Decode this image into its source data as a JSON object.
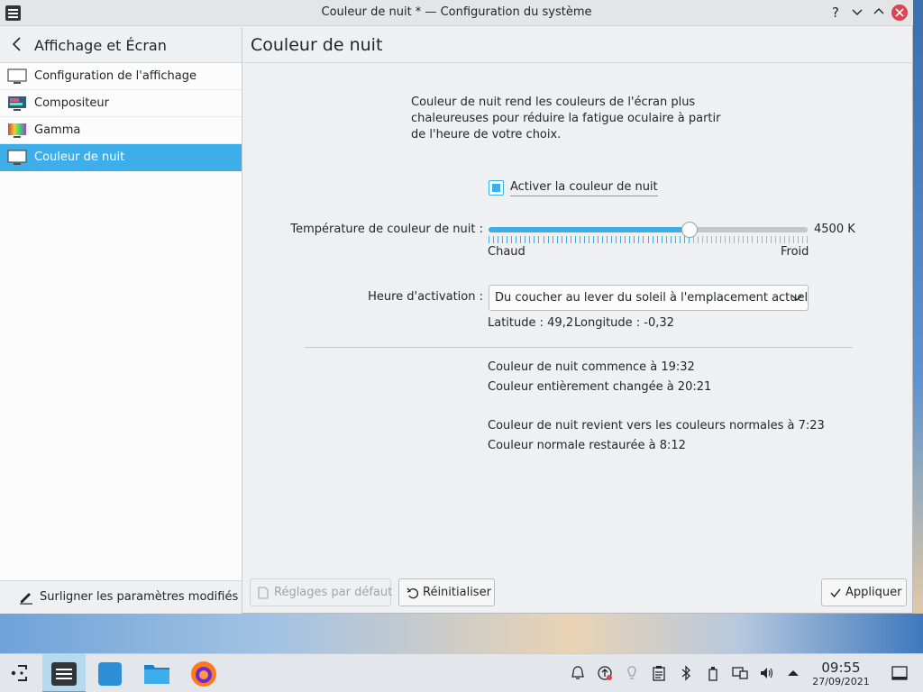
{
  "window": {
    "title": "Couleur de nuit * — Configuration du système",
    "buttons": {
      "help": "?",
      "minimize": "minimize",
      "maximize": "maximize",
      "close": "close"
    }
  },
  "sidebar": {
    "header": "Affichage et Écran",
    "items": [
      {
        "label": "Configuration de l'affichage",
        "icon": "display-icon",
        "active": false
      },
      {
        "label": "Compositeur",
        "icon": "compositor-icon",
        "active": false
      },
      {
        "label": "Gamma",
        "icon": "gamma-icon",
        "active": false
      },
      {
        "label": "Couleur de nuit",
        "icon": "night-color-icon",
        "active": true
      }
    ],
    "footer": "Surligner les paramètres modifiés"
  },
  "main": {
    "title": "Couleur de nuit",
    "description": "Couleur de nuit rend les couleurs de l'écran plus chaleureuses pour réduire la fatigue oculaire à partir de l'heure de votre choix.",
    "enable_label": "Activer la couleur de nuit",
    "enable_checked": true,
    "temperature": {
      "label": "Température de couleur de nuit :",
      "value_text": "4500 K",
      "level": 0.63,
      "warm_label": "Chaud",
      "cold_label": "Froid"
    },
    "activation": {
      "label": "Heure d'activation :",
      "selected": "Du coucher au lever du soleil à l'emplacement actuel"
    },
    "location": {
      "latitude": "Latitude : 49,2",
      "longitude": "Longitude : -0,32"
    },
    "schedule": {
      "start": "Couleur de nuit commence à 19:32",
      "full": "Couleur entièrement changée à 20:21",
      "revert": "Couleur de nuit revient vers les couleurs normales à 7:23",
      "restored": "Couleur normale restaurée à 8:12"
    },
    "buttons": {
      "defaults": "Réglages par défaut",
      "reset": "Réinitialiser",
      "apply": "Appliquer"
    }
  },
  "taskbar": {
    "time": "09:55",
    "date": "27/09/2021"
  },
  "colors": {
    "accent": "#3daee9",
    "close": "#da4453"
  }
}
